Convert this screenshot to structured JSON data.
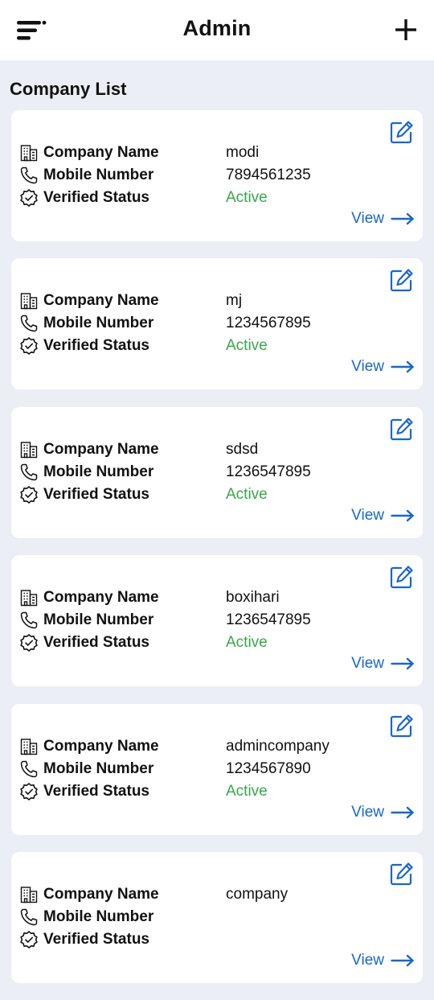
{
  "header": {
    "title": "Admin",
    "menu_icon": "menu-icon",
    "add_icon": "plus-icon"
  },
  "section": {
    "title": "Company List"
  },
  "card_labels": {
    "company_name": "Company Name",
    "mobile_number": "Mobile Number",
    "verified_status": "Verified Status",
    "view": "View"
  },
  "colors": {
    "accent": "#1a66c8",
    "active": "#3aa64a",
    "background": "#eceef5"
  },
  "companies": [
    {
      "name": "modi",
      "mobile": "7894561235",
      "status": "Active"
    },
    {
      "name": "mj",
      "mobile": "1234567895",
      "status": "Active"
    },
    {
      "name": "sdsd",
      "mobile": "1236547895",
      "status": "Active"
    },
    {
      "name": "boxihari",
      "mobile": "1236547895",
      "status": "Active"
    },
    {
      "name": "admincompany",
      "mobile": "1234567890",
      "status": "Active"
    },
    {
      "name": "company",
      "mobile": "",
      "status": ""
    }
  ]
}
